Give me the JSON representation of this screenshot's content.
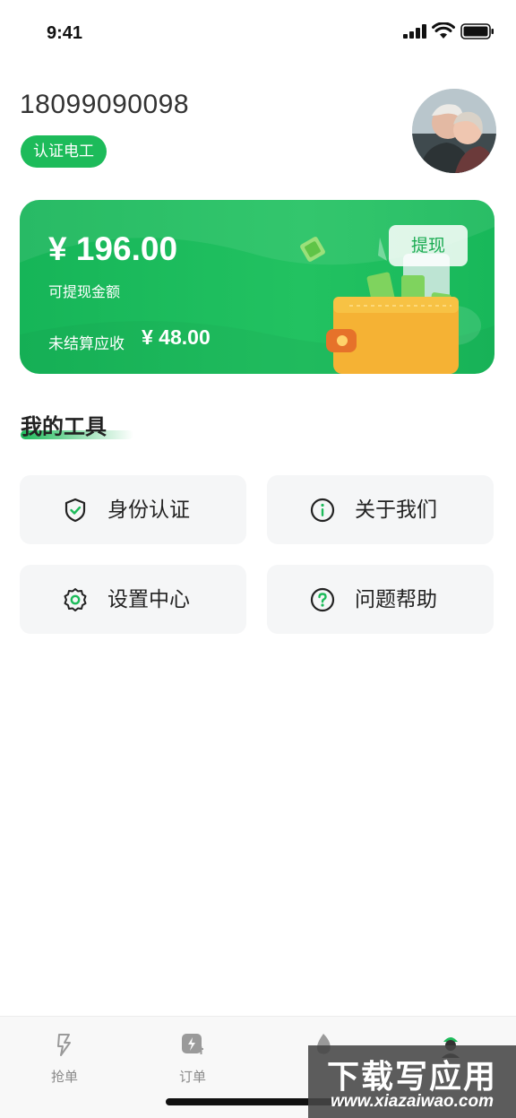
{
  "status_bar": {
    "time": "9:41"
  },
  "profile": {
    "phone": "18099090098",
    "badge": "认证电工"
  },
  "wallet": {
    "balance": "¥ 196.00",
    "balance_label": "可提现金额",
    "unsettled_label": "未结算应收",
    "unsettled_value": "¥ 48.00",
    "withdraw_label": "提现"
  },
  "tools_section": {
    "title": "我的工具",
    "items": [
      {
        "label": "身份认证",
        "icon": "shield-check-icon"
      },
      {
        "label": "关于我们",
        "icon": "info-icon"
      },
      {
        "label": "设置中心",
        "icon": "settings-gear-icon"
      },
      {
        "label": "问题帮助",
        "icon": "question-icon"
      }
    ]
  },
  "tabbar": {
    "items": [
      {
        "label": "抢单",
        "icon": "grab-order-icon"
      },
      {
        "label": "订单",
        "icon": "order-icon"
      }
    ]
  },
  "watermark": {
    "text": "下载写应用",
    "url": "www.xiazaiwao.com"
  },
  "colors": {
    "accent": "#1dbb5a",
    "card_bg": "#22c261",
    "tool_bg": "#f5f6f7"
  }
}
